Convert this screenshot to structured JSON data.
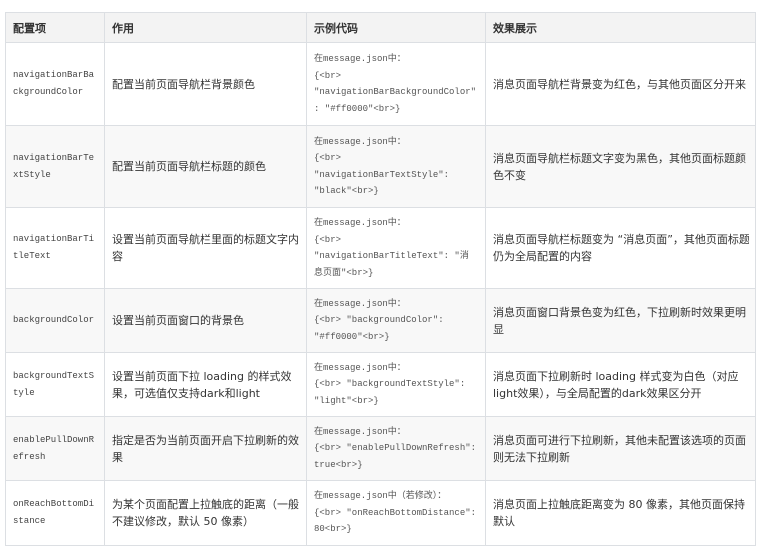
{
  "table": {
    "headers": [
      "配置项",
      "作用",
      "示例代码",
      "效果展示"
    ],
    "rows": [
      {
        "option": "navigationBarBackgroundColor",
        "purpose": [
          "配置当前页面导航栏背景颜色"
        ],
        "example": [
          "在message.json中：",
          "{<br>",
          "\"navigationBarBackgroundColor\"",
          ": \"#ff0000\"<br>}"
        ],
        "effect": [
          "消息页面导航栏背景变为红色，与其他页面区分开来"
        ]
      },
      {
        "option": "navigationBarTextStyle",
        "purpose": [
          "配置当前页面导航栏标题的颜色"
        ],
        "example": [
          "在message.json中：",
          "{<br>",
          "\"navigationBarTextStyle\":",
          "\"black\"<br>}"
        ],
        "effect": [
          "消息页面导航栏标题文字变为黑色，其他页面标题颜",
          "色不变"
        ]
      },
      {
        "option": "navigationBarTitleText",
        "purpose": [
          "设置当前页面导航栏里面的标题文字内",
          "容"
        ],
        "example": [
          "在message.json中：",
          "{<br>",
          "\"navigationBarTitleText\": \"消",
          "息页面\"<br>}"
        ],
        "effect": [
          "消息页面导航栏标题变为 “消息页面”，其他页面标题",
          "仍为全局配置的内容"
        ]
      },
      {
        "option": "backgroundColor",
        "purpose": [
          "设置当前页面窗口的背景色"
        ],
        "example": [
          "在message.json中：",
          "{<br> \"backgroundColor\":",
          "\"#ff0000\"<br>}"
        ],
        "effect": [
          "消息页面窗口背景色变为红色，下拉刷新时效果更明",
          "显"
        ]
      },
      {
        "option": "backgroundTextStyle",
        "purpose": [
          "设置当前页面下拉 loading 的样式效",
          "果，可选值仅支持dark和light"
        ],
        "example": [
          "在message.json中：",
          "{<br> \"backgroundTextStyle\":",
          "\"light\"<br>}"
        ],
        "effect": [
          "消息页面下拉刷新时 loading 样式变为白色（对应",
          "light效果），与全局配置的dark效果区分开"
        ]
      },
      {
        "option": "enablePullDownRefresh",
        "purpose": [
          "指定是否为当前页面开启下拉刷新的效",
          "果"
        ],
        "example": [
          "在message.json中：",
          "{<br> \"enablePullDownRefresh\":",
          "true<br>}"
        ],
        "effect": [
          "消息页面可进行下拉刷新，其他未配置该选项的页面",
          "则无法下拉刷新"
        ]
      },
      {
        "option": "onReachBottomDistance",
        "purpose": [
          "为某个页面配置上拉触底的距离（一般",
          "不建议修改，默认 50 像素）"
        ],
        "example": [
          "在message.json中（若修改）：",
          "{<br> \"onReachBottomDistance\":",
          "80<br>}"
        ],
        "effect": [
          "消息页面上拉触底距离变为 80 像素，其他页面保持",
          "默认"
        ]
      }
    ]
  }
}
